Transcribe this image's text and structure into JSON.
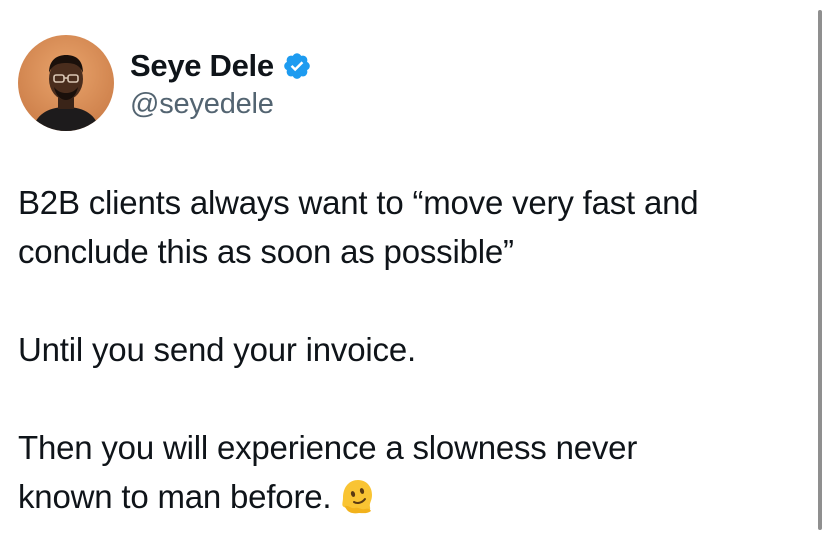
{
  "tweet": {
    "author": {
      "display_name": "Seye Dele",
      "handle": "@seyedele",
      "verified_icon": "verified-badge-icon",
      "avatar_icon": "avatar-photo"
    },
    "body": {
      "paragraph_1": {
        "line_1": "B2B clients always want to “move very fast and",
        "line_2": "conclude this as soon as possible”"
      },
      "paragraph_2": {
        "line_1": "Until you send your invoice."
      },
      "paragraph_3": {
        "line_1": "Then you will experience a slowness never",
        "line_2": "known to man before.",
        "emoji_icon": "melting-face-emoji-icon"
      }
    }
  },
  "colors": {
    "text_primary": "#0f1419",
    "text_secondary": "#536471",
    "verified_blue": "#1d9bf0",
    "background": "#ffffff",
    "emoji_yellow": "#f9c433"
  }
}
